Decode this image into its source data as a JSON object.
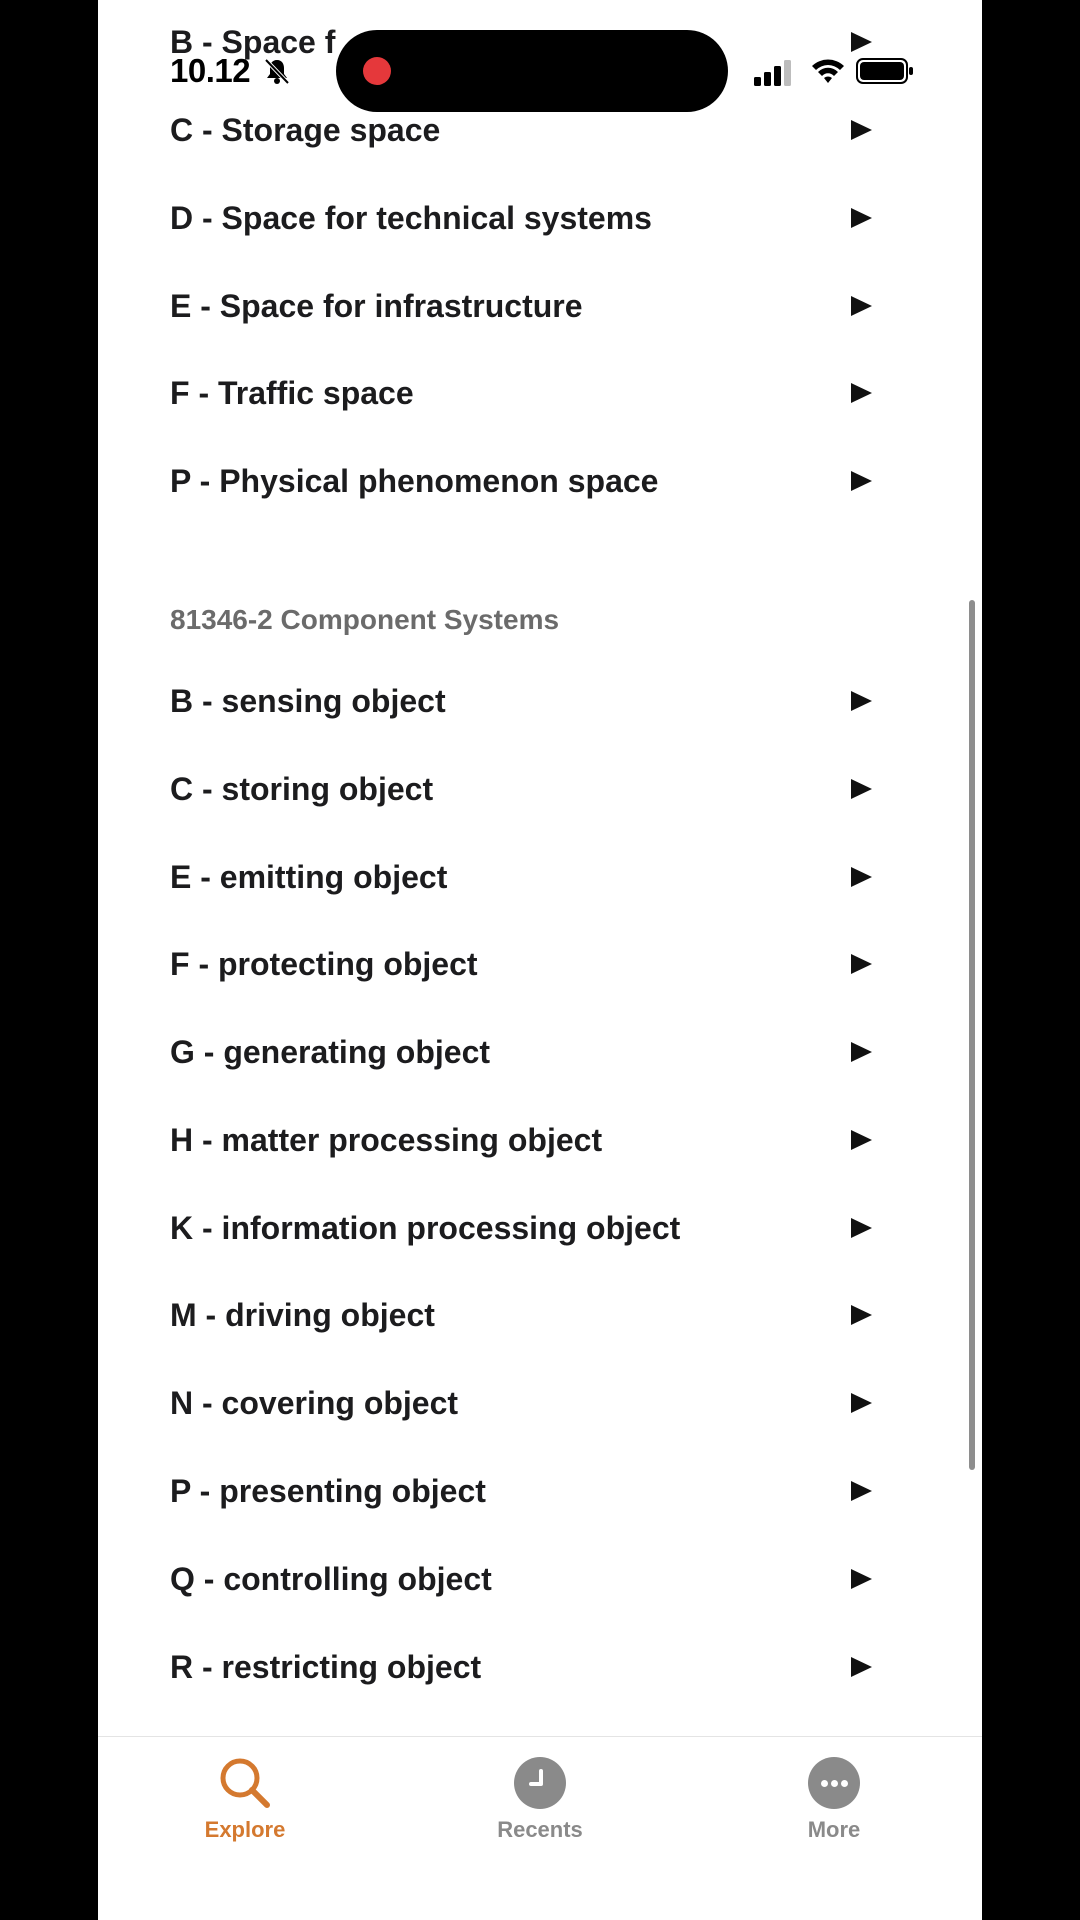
{
  "status_bar": {
    "time": "10.12",
    "icons": [
      "bell-slash-icon",
      "recording-dot-icon",
      "cellular-signal-icon",
      "wifi-icon",
      "battery-icon"
    ]
  },
  "partial_row": {
    "label": "B - Space f"
  },
  "spaces": [
    {
      "label": "C - Storage space"
    },
    {
      "label": "D - Space for technical systems"
    },
    {
      "label": "E - Space for infrastructure"
    },
    {
      "label": "F - Traffic space"
    },
    {
      "label": "P - Physical phenomenon space"
    }
  ],
  "component_section": {
    "title": "81346-2 Component Systems",
    "items": [
      {
        "label": "B - sensing object"
      },
      {
        "label": "C - storing object"
      },
      {
        "label": "E - emitting object"
      },
      {
        "label": "F - protecting object"
      },
      {
        "label": "G - generating object"
      },
      {
        "label": "H - matter processing object"
      },
      {
        "label": "K - information processing object"
      },
      {
        "label": "M - driving object"
      },
      {
        "label": "N - covering object"
      },
      {
        "label": "P - presenting object"
      },
      {
        "label": "Q - controlling object"
      },
      {
        "label": "R - restricting object"
      }
    ]
  },
  "tab_bar": {
    "tabs": [
      {
        "label": "Explore",
        "icon": "search-icon",
        "active": true
      },
      {
        "label": "Recents",
        "icon": "clock-icon",
        "active": false
      },
      {
        "label": "More",
        "icon": "more-icon",
        "active": false
      }
    ]
  },
  "colors": {
    "accent": "#d4792f",
    "inactive": "#8a8a8a",
    "text": "#1c1c1e",
    "section_header": "#6b6b6b",
    "record": "#e5383b"
  }
}
